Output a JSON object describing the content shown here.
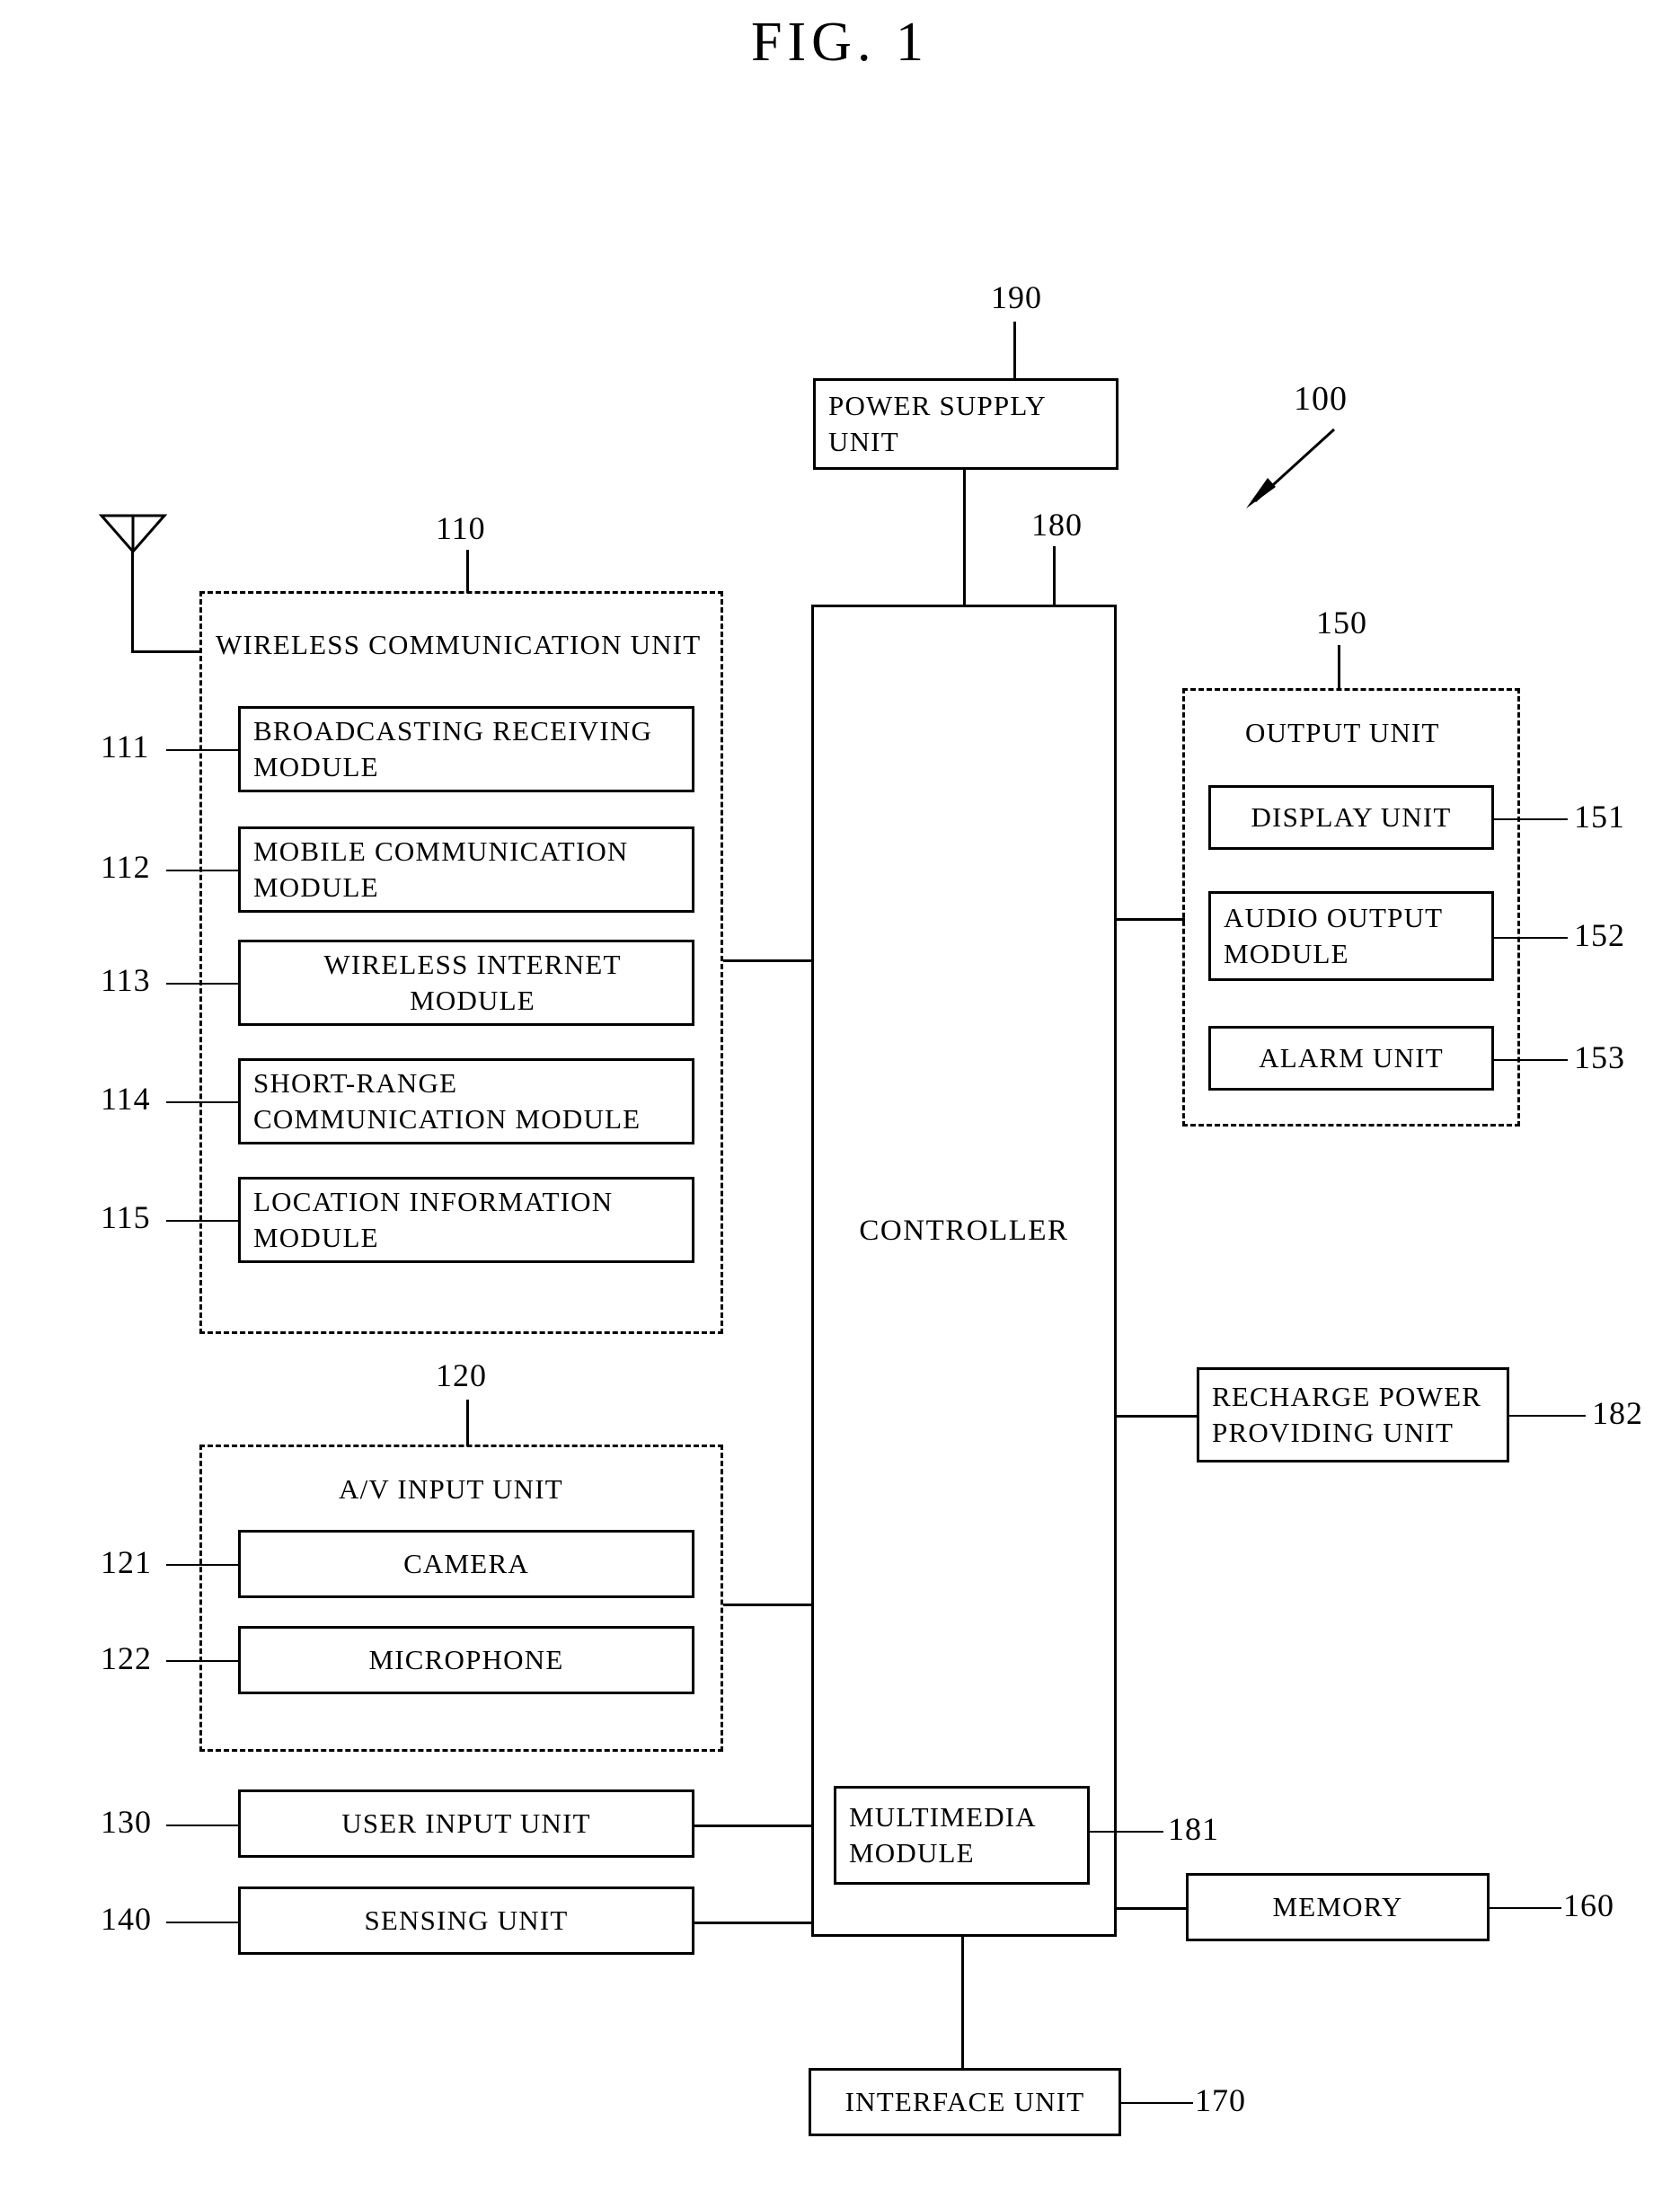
{
  "figure": {
    "title": "FIG.  1",
    "system_ref": "100"
  },
  "blocks": {
    "power_supply": {
      "label": "POWER SUPPLY\nUNIT",
      "ref": "190"
    },
    "controller": {
      "label": "CONTROLLER",
      "ref": "180"
    },
    "multimedia": {
      "label": "MULTIMEDIA\nMODULE",
      "ref": "181"
    },
    "recharge": {
      "label": "RECHARGE POWER\nPROVIDING UNIT",
      "ref": "182"
    },
    "memory": {
      "label": "MEMORY",
      "ref": "160"
    },
    "interface": {
      "label": "INTERFACE UNIT",
      "ref": "170"
    },
    "user_input": {
      "label": "USER INPUT UNIT",
      "ref": "130"
    },
    "sensing": {
      "label": "SENSING UNIT",
      "ref": "140"
    }
  },
  "wireless_communication_unit": {
    "title": "WIRELESS COMMUNICATION UNIT",
    "ref": "110",
    "modules": [
      {
        "ref": "111",
        "label": "BROADCASTING RECEIVING\nMODULE"
      },
      {
        "ref": "112",
        "label": "MOBILE COMMUNICATION\nMODULE"
      },
      {
        "ref": "113",
        "label": "WIRELESS INTERNET\nMODULE"
      },
      {
        "ref": "114",
        "label": "SHORT-RANGE\nCOMMUNICATION MODULE"
      },
      {
        "ref": "115",
        "label": "LOCATION INFORMATION\nMODULE"
      }
    ]
  },
  "av_input_unit": {
    "title": "A/V INPUT UNIT",
    "ref": "120",
    "modules": [
      {
        "ref": "121",
        "label": "CAMERA"
      },
      {
        "ref": "122",
        "label": "MICROPHONE"
      }
    ]
  },
  "output_unit": {
    "title": "OUTPUT UNIT",
    "ref": "150",
    "modules": [
      {
        "ref": "151",
        "label": "DISPLAY UNIT"
      },
      {
        "ref": "152",
        "label": "AUDIO OUTPUT\nMODULE"
      },
      {
        "ref": "153",
        "label": "ALARM UNIT"
      }
    ]
  },
  "icons": {
    "antenna": "antenna-icon",
    "lead_arrow": "leader-arrow-icon"
  },
  "colors": {
    "ink": "#000000",
    "paper": "#ffffff"
  }
}
